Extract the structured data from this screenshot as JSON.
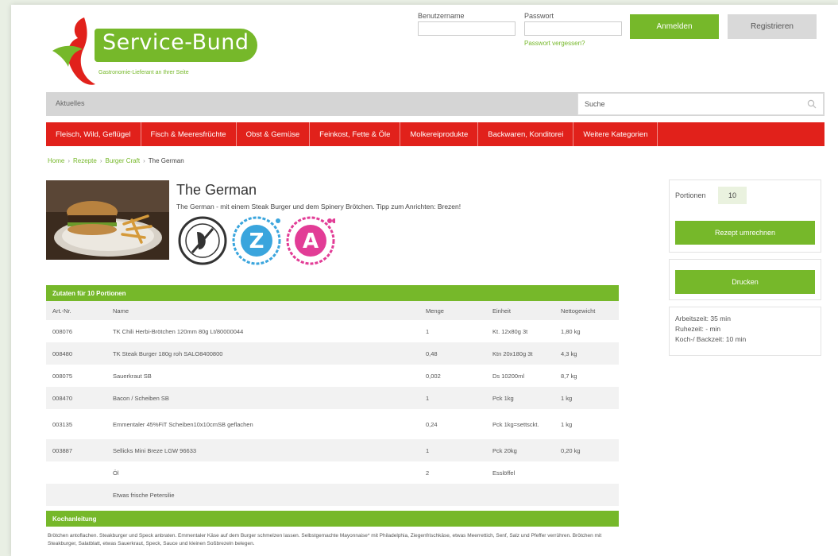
{
  "header": {
    "logo_text": "Service-Bund",
    "logo_tagline": "Gastronomie-Lieferant an Ihrer Seite",
    "username_label": "Benutzername",
    "password_label": "Passwort",
    "forgot_password": "Passwort vergessen?",
    "login_button": "Anmelden",
    "register_button": "Registrieren",
    "brand_green": "#76b82a",
    "brand_red": "#e1211b"
  },
  "topbar": {
    "aktuelles": "Aktuelles",
    "search_placeholder": "Suche",
    "search_icon": "magnifier-icon"
  },
  "categories": [
    "Fleisch, Wild, Geflügel",
    "Fisch & Meeresfrüchte",
    "Obst & Gemüse",
    "Feinkost, Fette & Öle",
    "Molkereiprodukte",
    "Backwaren, Konditorei",
    "Weitere Kategorien"
  ],
  "breadcrumb": [
    "Home",
    "Rezepte",
    "Burger Craft",
    "The German"
  ],
  "recipe": {
    "title": "The German",
    "subtitle": "The German - mit einem Steak Burger und dem Spinery Brötchen. Tipp zum Anrichten: Brezen!",
    "badges": [
      "vegan-free-icon",
      "z-badge-icon",
      "a-badge-icon"
    ]
  },
  "side": {
    "portions_label": "Portionen",
    "portions_value": "10",
    "recalc_button": "Rezept umrechnen",
    "print_button": "Drucken",
    "times": [
      "Arbeitszeit: 35 min",
      "Ruhezeit: - min",
      "Koch-/ Backzeit: 10 min"
    ]
  },
  "ingredients": {
    "heading": "Zutaten für 10 Portionen",
    "columns": [
      "Art.-Nr.",
      "Name",
      "Menge",
      "Einheit",
      "Nettogewicht"
    ],
    "rows": [
      [
        "008076",
        "TK Chili Herbi-Brötchen 120mm 80g Lt/80000044",
        "1",
        "Kt. 12x80g 3t",
        "1,80 kg"
      ],
      [
        "008480",
        "TK Steak Burger 180g roh SALO8400800",
        "0,48",
        "Ktn 20x180g 3t",
        "4,3 kg"
      ],
      [
        "008075",
        "Sauerkraut SB",
        "0,002",
        "Ds 10200ml",
        "8,7 kg"
      ],
      [
        "008470",
        "Bacon / Scheiben SB",
        "1",
        "Pck 1kg",
        "1 kg"
      ],
      [
        "003135",
        "Emmentaler 45%FiT Scheiben10x10cmSB geflachen",
        "0,24",
        "Pck 1kg=settsckt.",
        "1 kg"
      ],
      [
        "003887",
        "Sellicks Mini Breze LGW 96633",
        "1",
        "Pck 20kg",
        "0,20 kg"
      ],
      [
        "",
        "Öl",
        "2",
        "Esslöffel",
        ""
      ],
      [
        "",
        "Etwas frische Petersilie",
        "",
        "",
        ""
      ]
    ]
  },
  "instructions": {
    "heading": "Kochanleitung",
    "text": "Brötchen antoflachen. Steakburger und Speck anbraten. Emmentaler Käse auf dem Burger schmelzen lassen. Selbstgemachte Mayonnaise* mit Philadelphia, Ziegenfrischkäse, etwas Meerrettich, Senf, Salz und Pfeffer verrühren. Brötchen mit Steakburger, Salatblatt, etwas Sauerkraut, Speck, Sauce und kleinen Soßbrezeln belegen."
  }
}
